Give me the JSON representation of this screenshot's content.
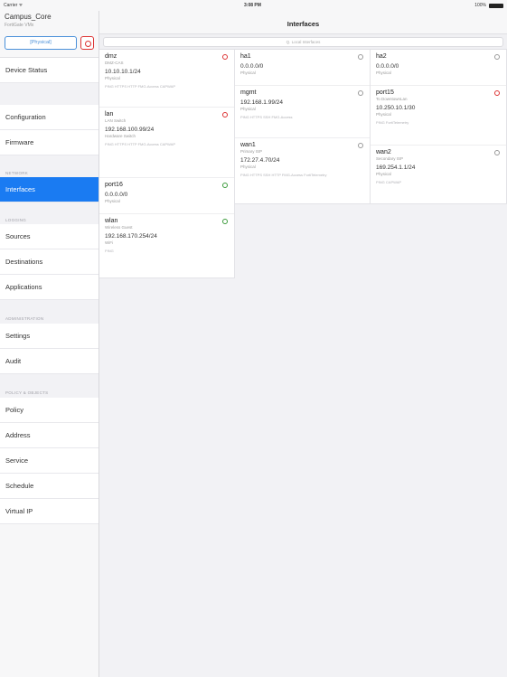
{
  "status_bar": {
    "carrier": "Carrier ᯤ",
    "time": "3:08 PM",
    "battery": "100%"
  },
  "sidebar": {
    "title": "Campus_Core",
    "subtitle": "FortiGate VMx",
    "device_button": "[Physical]",
    "items": [
      {
        "label": "Device Status"
      },
      {
        "label": "Configuration"
      },
      {
        "label": "Firmware"
      },
      {
        "section": "NETWORK"
      },
      {
        "label": "Interfaces"
      },
      {
        "section": "LOGGING"
      },
      {
        "label": "Sources"
      },
      {
        "label": "Destinations"
      },
      {
        "label": "Applications"
      },
      {
        "section": "ADMINISTRATION"
      },
      {
        "label": "Settings"
      },
      {
        "label": "Audit"
      },
      {
        "section": "POLICY & OBJECTS"
      },
      {
        "label": "Policy"
      },
      {
        "label": "Address"
      },
      {
        "label": "Service"
      },
      {
        "label": "Schedule"
      },
      {
        "label": "Virtual IP"
      }
    ]
  },
  "main": {
    "title": "Interfaces",
    "search_placeholder": "Q. Local Interfaces"
  },
  "interfaces": {
    "col1": [
      {
        "name": "dmz",
        "type": "DMZ-CAS",
        "ip": "10.10.10.1/24",
        "mode": "Physical",
        "access": "PING HTTPS HTTP FMG-Access CAPWAP",
        "status": "down"
      },
      {
        "name": "lan",
        "type": "LAN Switch",
        "ip": "192.168.100.99/24",
        "mode": "Hardware Switch",
        "access": "PING HTTPS HTTP FMG-Access CAPWAP",
        "status": "down"
      },
      {
        "name": "port16",
        "type": "",
        "ip": "0.0.0.0/0",
        "mode": "Physical",
        "access": "",
        "status": "up"
      },
      {
        "name": "wlan",
        "type": "Wireless Guest",
        "ip": "192.168.170.254/24",
        "mode": "WiFi",
        "access": "PING",
        "status": "up"
      }
    ],
    "col2": [
      {
        "name": "ha1",
        "type": "",
        "ip": "0.0.0.0/0",
        "mode": "Physical",
        "access": "",
        "status": "neutral"
      },
      {
        "name": "mgmt",
        "type": "",
        "ip": "192.168.1.99/24",
        "mode": "Physical",
        "access": "PING HTTPS SSH FMG-Access",
        "status": "neutral"
      },
      {
        "name": "wan1",
        "type": "Primary ISP",
        "ip": "172.27.4.70/24",
        "mode": "Physical",
        "access": "PING HTTPS SSH HTTP FMG-Access FortiTelemetry",
        "status": "neutral"
      }
    ],
    "col3": [
      {
        "name": "ha2",
        "type": "",
        "ip": "0.0.0.0/0",
        "mode": "Physical",
        "access": "",
        "status": "neutral"
      },
      {
        "name": "port15",
        "type": "To DowntownLan",
        "ip": "10.250.10.1/30",
        "mode": "Physical",
        "access": "PING FortiTelemetry",
        "status": "down"
      },
      {
        "name": "wan2",
        "type": "Secondary ISP",
        "ip": "169.254.1.1/24",
        "mode": "Physical",
        "access": "PING CAPWAP",
        "status": "neutral"
      }
    ]
  },
  "colors": {
    "accent": "#1a7bf2",
    "down": "#dd3333",
    "up": "#3a9a3a"
  }
}
